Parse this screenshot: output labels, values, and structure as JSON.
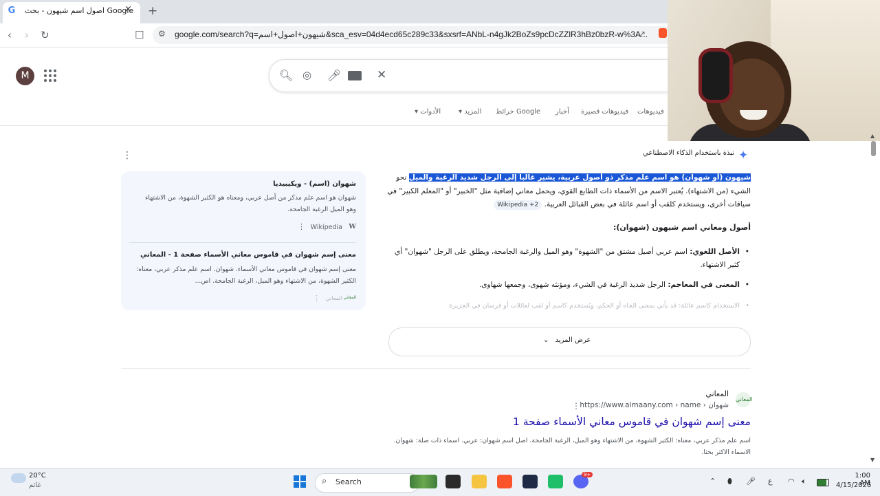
{
  "browser": {
    "tab_title": "اصول اسم شيهون - بحث Google",
    "tab_favicon": "G",
    "tab_close": "×",
    "new_tab": "+",
    "url": "google.com/search?q=شيهون+اصول+اسم&sca_esv=04d4ecd65c289c33&sxsrf=ANbL-n4gJk2BoZs9pcDcZZlR3hBz0bzR-w%3A..."
  },
  "google": {
    "avatar_letter": "M",
    "nav_tabs": [
      "فيديوهات",
      "فيديوهات قصيرة",
      "أخبار",
      "خرائط Google",
      "المزيد",
      "الأدوات"
    ]
  },
  "ai_overview": {
    "label": "نبذة باستخدام الذكاء الاصطناعي",
    "highlight": "شيهون (أو شهوان) هو اسم علم مذكر ذو أصول عربية، يشير غالباً إلى الرجل شديد الرغبة والميل",
    "paragraph": " نحو الشيء (من الاشتهاء). يُعتبر الاسم من الأسماء ذات الطابع القوي، ويحمل معاني إضافية مثل \"الخبير\" أو \"المعلم الكبير\" في سياقات أخرى، ويستخدم كلقب أو اسم عائلة في بعض القبائل العربية.",
    "chip": "Wikipedia +2",
    "heading": "أصول ومعاني اسم شيهون (شهوان):",
    "bullets": [
      {
        "bold": "الأصل اللغوي:",
        "text": " اسم عربي أصيل مشتق من \"الشهوة\" وهو الميل والرغبة الجامحة، ويطلق على الرجل \"شهوان\" أي كثير الاشتهاء."
      },
      {
        "bold": "المعنى في المعاجم:",
        "text": " الرجل شديد الرغبة في الشيء، ومؤنثه شهوى، وجمعها شهاوى."
      },
      {
        "bold": "",
        "text": "الاستخدام كاسم عائلة: قد يأتي بمعنى الجاه أو الحكم، ويُستخدم كاسم أو لقب لعائلات أو فرسان في الجزيرة"
      }
    ],
    "show_more": "عرض المزيد",
    "sources": [
      {
        "title": "شهوان (اسم) - ويكيبيديا",
        "snippet": "شهوان هو اسم علم مذكر من أصل عربي، ومعناه هو الكثير الشهوة، من الاشتهاء وهو الميل الرغبة الجامحة.",
        "site": "Wikipedia",
        "logo": "W"
      },
      {
        "title": "معنى إسم شهوان في قاموس معاني الأسماء صفحة 1 - المعاني",
        "snippet": "معنى إسم شهوان في قاموس معاني الأسماء. شهوان. اسم علم مذكر عربي، معناه: الكثير الشهوة، من الاشتهاء وهو الميل، الرغبة الجامحة. اص...",
        "site": "المعاني",
        "logo": "المعاني"
      }
    ]
  },
  "result": {
    "site_name": "المعاني",
    "favicon_text": "المعاني",
    "url": "https://www.almaany.com › name › شهوان",
    "title": "معنى إسم شهوان في قاموس معاني الأسماء صفحة 1",
    "snippet": "اسم علم مذكر عربي، معناه: الكثير الشهوة، من الاشتهاء وهو الميل، الرغبة الجامحة. اصل اسم شهوان: عربي. اسماء ذات صلة: شهوان. الاسماء الاكثر بحثا."
  },
  "taskbar": {
    "temp": "20°C",
    "weather_desc": "غائم",
    "search_label": "Search",
    "lang": "ع",
    "time": "1:00 AM",
    "date": "4/15/2026",
    "badge": "9+"
  }
}
